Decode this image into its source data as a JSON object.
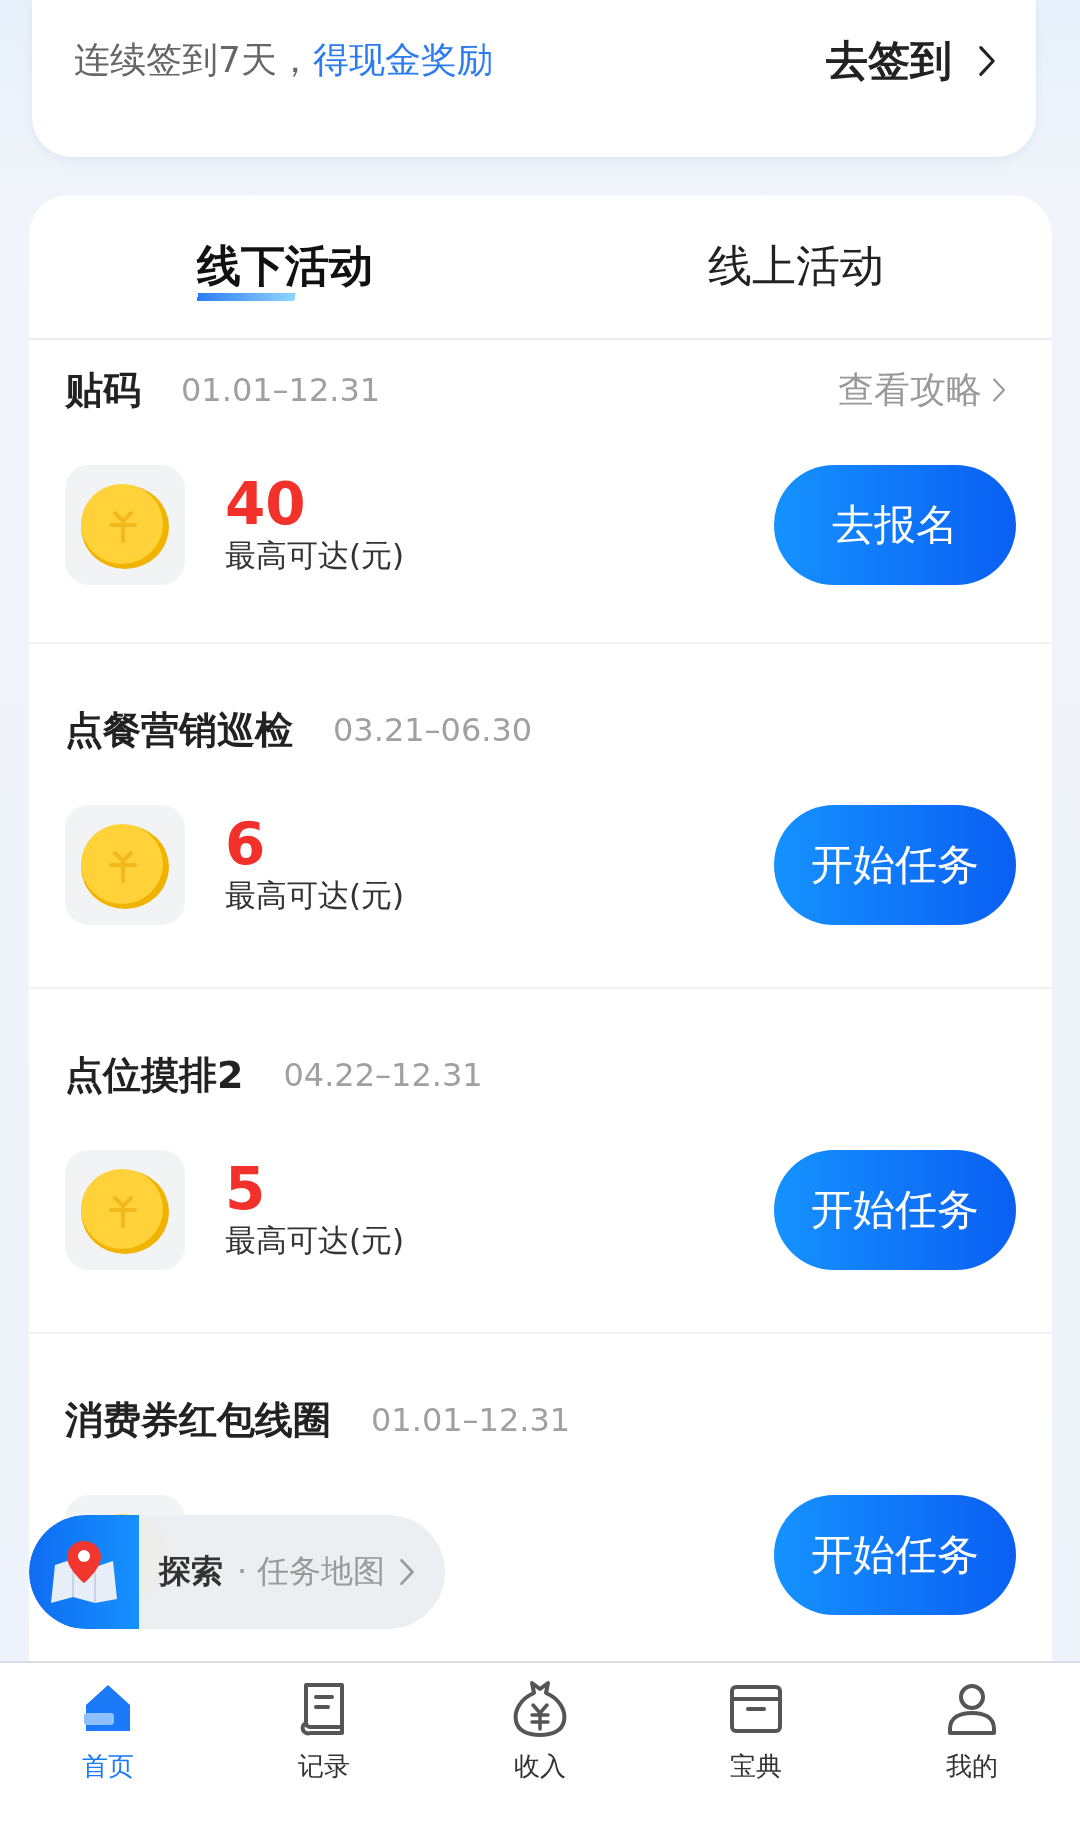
{
  "signin": {
    "text": "连续签到7天，",
    "highlight": "得现金奖励",
    "action": "去签到"
  },
  "tabs": [
    {
      "label": "线下活动",
      "selected": true
    },
    {
      "label": "线上活动",
      "selected": false
    }
  ],
  "activities": [
    {
      "title": "贴码",
      "dates": "01.01–12.31",
      "guide": "查看攻略",
      "amount": "40",
      "amount_label": "最高可达(元)",
      "button": "去报名"
    },
    {
      "title": "点餐营销巡检",
      "dates": "03.21–06.30",
      "amount": "6",
      "amount_label": "最高可达(元)",
      "button": "开始任务"
    },
    {
      "title": "点位摸排2",
      "dates": "04.22–12.31",
      "amount": "5",
      "amount_label": "最高可达(元)",
      "button": "开始任务"
    },
    {
      "title": "消费券红包线圈",
      "dates": "01.01–12.31",
      "button": "开始任务"
    }
  ],
  "map_button": {
    "label": "探索",
    "sublabel": "· 任务地图"
  },
  "nav": [
    {
      "label": "首页",
      "selected": true
    },
    {
      "label": "记录",
      "selected": false
    },
    {
      "label": "收入",
      "selected": false
    },
    {
      "label": "宝典",
      "selected": false
    },
    {
      "label": "我的",
      "selected": false
    }
  ]
}
